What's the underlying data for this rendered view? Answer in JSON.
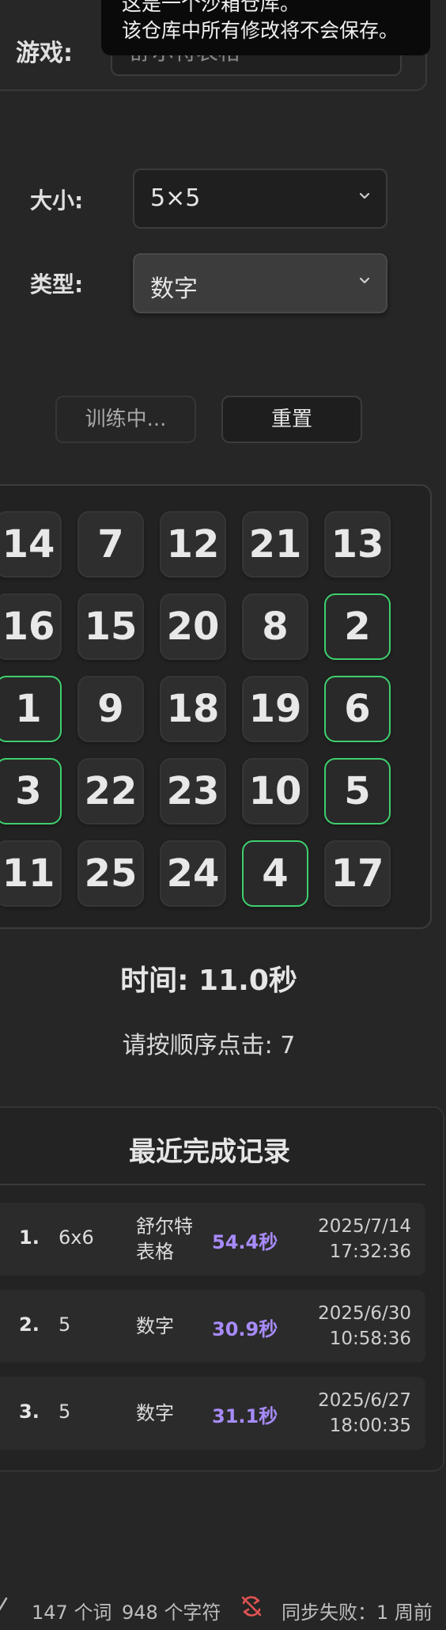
{
  "toast": {
    "line1": "这是一个沙箱仓库。",
    "line2": "该仓库中所有修改将不会保存。"
  },
  "game": {
    "label": "游戏:",
    "value": "舒尔特表格"
  },
  "settings": {
    "size_label": "大小:",
    "size_value": "5×5",
    "type_label": "类型:",
    "type_value": "数字"
  },
  "buttons": {
    "training": "训练中...",
    "reset": "重置"
  },
  "grid": {
    "cells": [
      "14",
      "7",
      "12",
      "21",
      "13",
      "16",
      "15",
      "20",
      "8",
      "2",
      "1",
      "9",
      "18",
      "19",
      "6",
      "3",
      "22",
      "23",
      "10",
      "5",
      "11",
      "25",
      "24",
      "4",
      "17"
    ],
    "completed": [
      "1",
      "2",
      "3",
      "4",
      "5",
      "6"
    ],
    "completed_color": "#3ecf6e"
  },
  "status": {
    "timer": "时间: 11.0秒",
    "prompt": "请按顺序点击: 7"
  },
  "records": {
    "title": "最近完成记录",
    "rows": [
      {
        "idx": "1.",
        "size": "6x6",
        "type": "舒尔特表格",
        "time": "54.4秒",
        "date": "2025/7/14",
        "clock": "17:32:36"
      },
      {
        "idx": "2.",
        "size": "5",
        "type": "数字",
        "time": "30.9秒",
        "date": "2025/6/30",
        "clock": "10:58:36"
      },
      {
        "idx": "3.",
        "size": "5",
        "type": "数字",
        "time": "31.1秒",
        "date": "2025/6/27",
        "clock": "18:00:35"
      }
    ],
    "time_color": "#a78bfa"
  },
  "statusbar": {
    "words": "147 个词",
    "chars": "948 个字符",
    "sync": "同步失败：1 周前",
    "sync_icon": "sync-failed-icon"
  }
}
